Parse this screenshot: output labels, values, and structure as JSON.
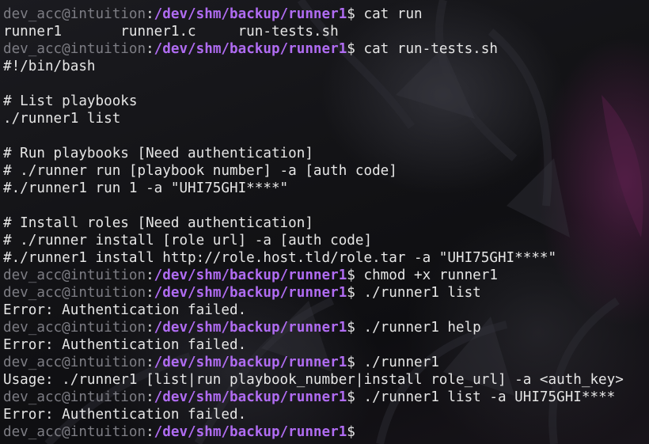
{
  "colors": {
    "prompt_user": "#7d7d84",
    "prompt_path": "#b06cf2",
    "text": "#e6e6e6",
    "background": "#111114"
  },
  "terminal": {
    "lines": [
      {
        "type": "prompt",
        "user": "dev_acc@intuition",
        "sep": ":",
        "path": "/dev/shm/backup/runner1",
        "sym": "$ ",
        "cmd": "cat run"
      },
      {
        "type": "output",
        "text": "runner1       runner1.c     run-tests.sh"
      },
      {
        "type": "prompt",
        "user": "dev_acc@intuition",
        "sep": ":",
        "path": "/dev/shm/backup/runner1",
        "sym": "$ ",
        "cmd": "cat run-tests.sh"
      },
      {
        "type": "output",
        "text": "#!/bin/bash"
      },
      {
        "type": "output",
        "text": ""
      },
      {
        "type": "output",
        "text": "# List playbooks"
      },
      {
        "type": "output",
        "text": "./runner1 list"
      },
      {
        "type": "output",
        "text": ""
      },
      {
        "type": "output",
        "text": "# Run playbooks [Need authentication]"
      },
      {
        "type": "output",
        "text": "# ./runner run [playbook number] -a [auth code]"
      },
      {
        "type": "output",
        "text": "#./runner1 run 1 -a \"UHI75GHI****\""
      },
      {
        "type": "output",
        "text": ""
      },
      {
        "type": "output",
        "text": "# Install roles [Need authentication]"
      },
      {
        "type": "output",
        "text": "# ./runner install [role url] -a [auth code]"
      },
      {
        "type": "output",
        "text": "#./runner1 install http://role.host.tld/role.tar -a \"UHI75GHI****\""
      },
      {
        "type": "prompt",
        "user": "dev_acc@intuition",
        "sep": ":",
        "path": "/dev/shm/backup/runner1",
        "sym": "$ ",
        "cmd": "chmod +x runner1"
      },
      {
        "type": "prompt",
        "user": "dev_acc@intuition",
        "sep": ":",
        "path": "/dev/shm/backup/runner1",
        "sym": "$ ",
        "cmd": "./runner1 list"
      },
      {
        "type": "output",
        "text": "Error: Authentication failed."
      },
      {
        "type": "prompt",
        "user": "dev_acc@intuition",
        "sep": ":",
        "path": "/dev/shm/backup/runner1",
        "sym": "$ ",
        "cmd": "./runner1 help"
      },
      {
        "type": "output",
        "text": "Error: Authentication failed."
      },
      {
        "type": "prompt",
        "user": "dev_acc@intuition",
        "sep": ":",
        "path": "/dev/shm/backup/runner1",
        "sym": "$ ",
        "cmd": "./runner1"
      },
      {
        "type": "output",
        "text": "Usage: ./runner1 [list|run playbook_number|install role_url] -a <auth_key>"
      },
      {
        "type": "prompt",
        "user": "dev_acc@intuition",
        "sep": ":",
        "path": "/dev/shm/backup/runner1",
        "sym": "$ ",
        "cmd": "./runner1 list -a UHI75GHI****"
      },
      {
        "type": "output",
        "text": "Error: Authentication failed."
      },
      {
        "type": "prompt",
        "user": "dev_acc@intuition",
        "sep": ":",
        "path": "/dev/shm/backup/runner1",
        "sym": "$ ",
        "cmd": ""
      }
    ]
  }
}
